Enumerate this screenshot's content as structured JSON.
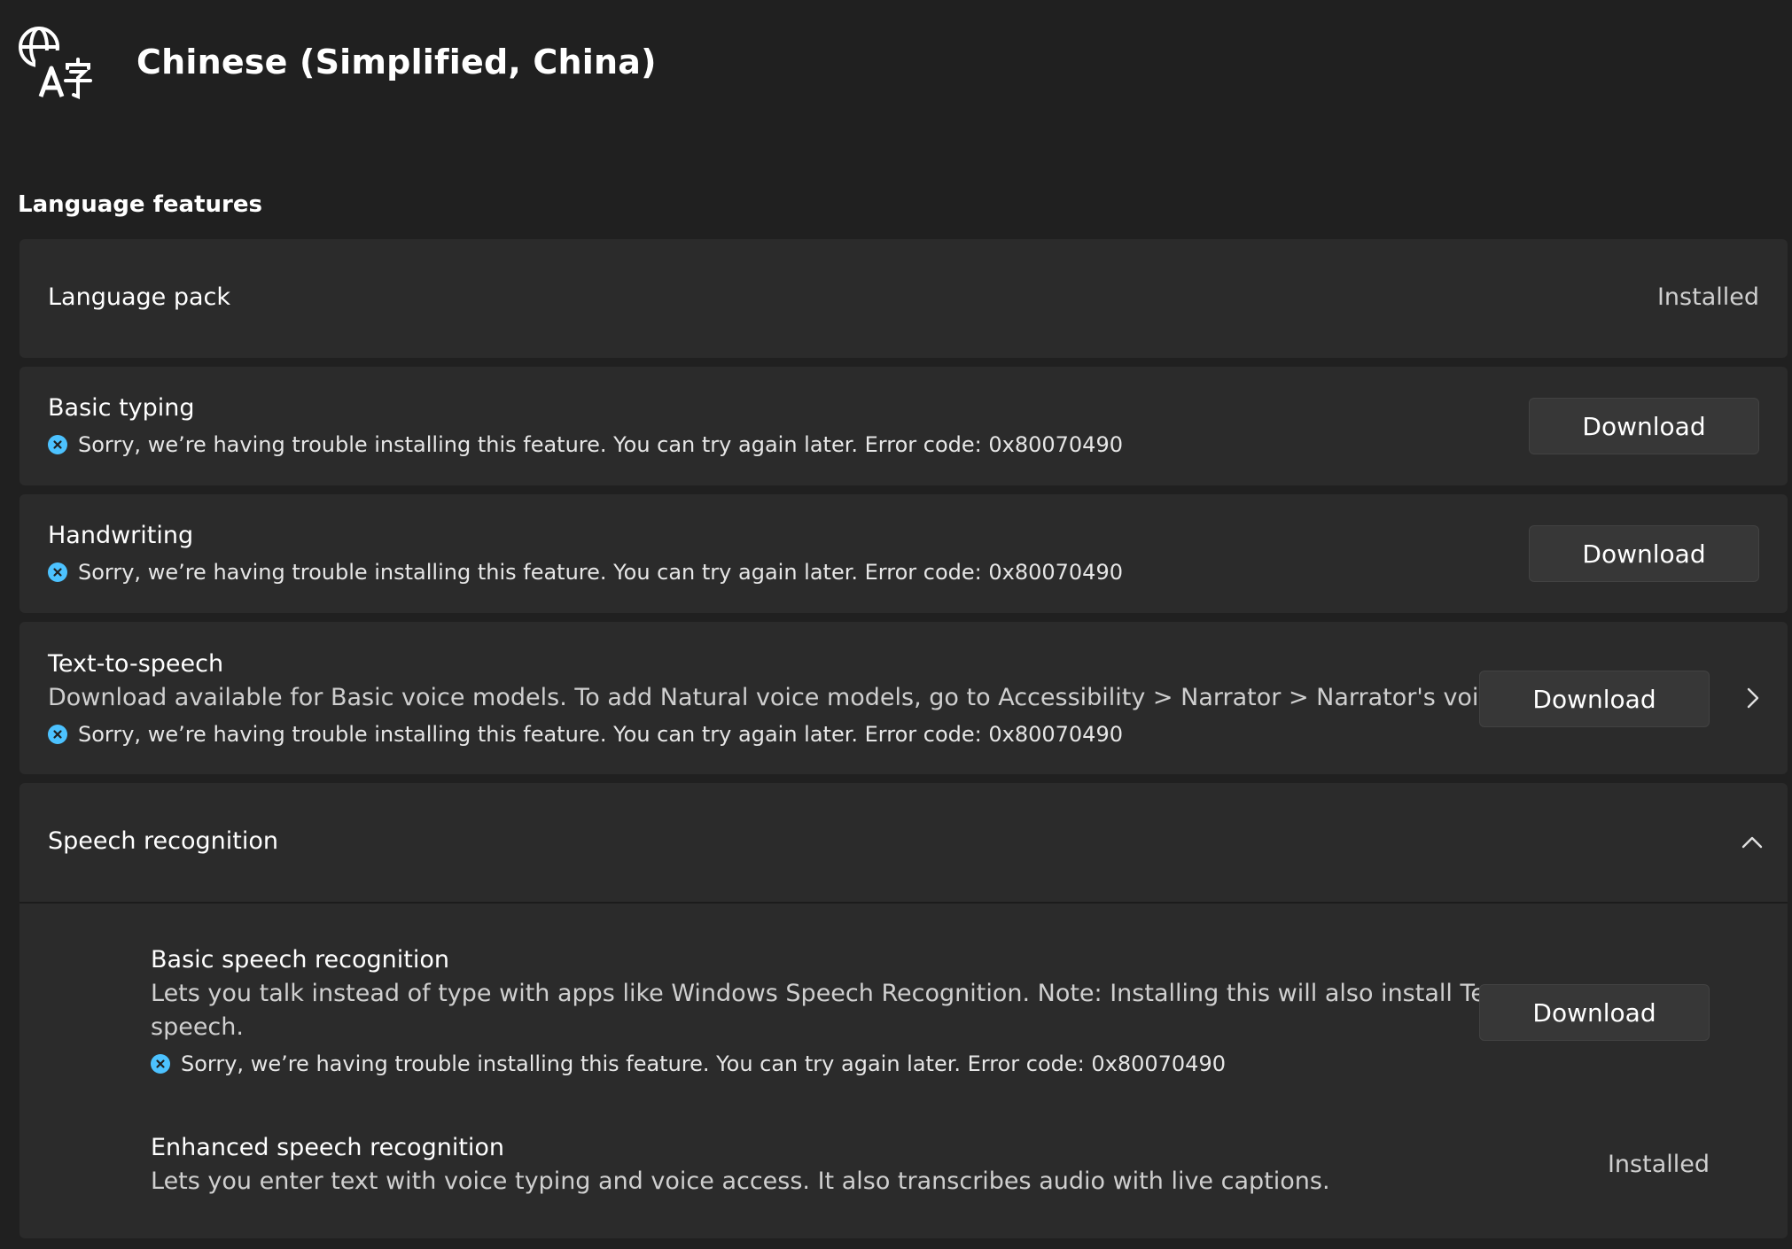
{
  "header": {
    "icon": "language-icon",
    "title": "Chinese (Simplified, China)"
  },
  "section": {
    "title": "Language features"
  },
  "features": {
    "language_pack": {
      "title": "Language pack",
      "status": "Installed"
    },
    "basic_typing": {
      "title": "Basic typing",
      "error": "Sorry, we’re having trouble installing this feature. You can try again later. Error code: 0x80070490",
      "button": "Download"
    },
    "handwriting": {
      "title": "Handwriting",
      "error": "Sorry, we’re having trouble installing this feature. You can try again later. Error code: 0x80070490",
      "button": "Download"
    },
    "tts": {
      "title": "Text-to-speech",
      "desc": "Download available for Basic voice models. To add Natural voice models, go to Accessibility > Narrator > Narrator's voice",
      "error": "Sorry, we’re having trouble installing this feature. You can try again later. Error code: 0x80070490",
      "button": "Download"
    },
    "speech": {
      "title": "Speech recognition",
      "basic": {
        "title": "Basic speech recognition",
        "desc_line1": "Lets you talk instead of type with apps like Windows Speech Recognition. Note: Installing this will also install Text-to-",
        "desc_line2": "speech.",
        "error": "Sorry, we’re having trouble installing this feature. You can try again later. Error code: 0x80070490",
        "button": "Download"
      },
      "enhanced": {
        "title": "Enhanced speech recognition",
        "desc": "Lets you enter text with voice typing and voice access. It also transcribes audio with live captions.",
        "status": "Installed"
      }
    }
  },
  "colors": {
    "accent": "#4cc2ff",
    "background": "#202020",
    "card": "#2b2b2b",
    "button": "#373737"
  }
}
